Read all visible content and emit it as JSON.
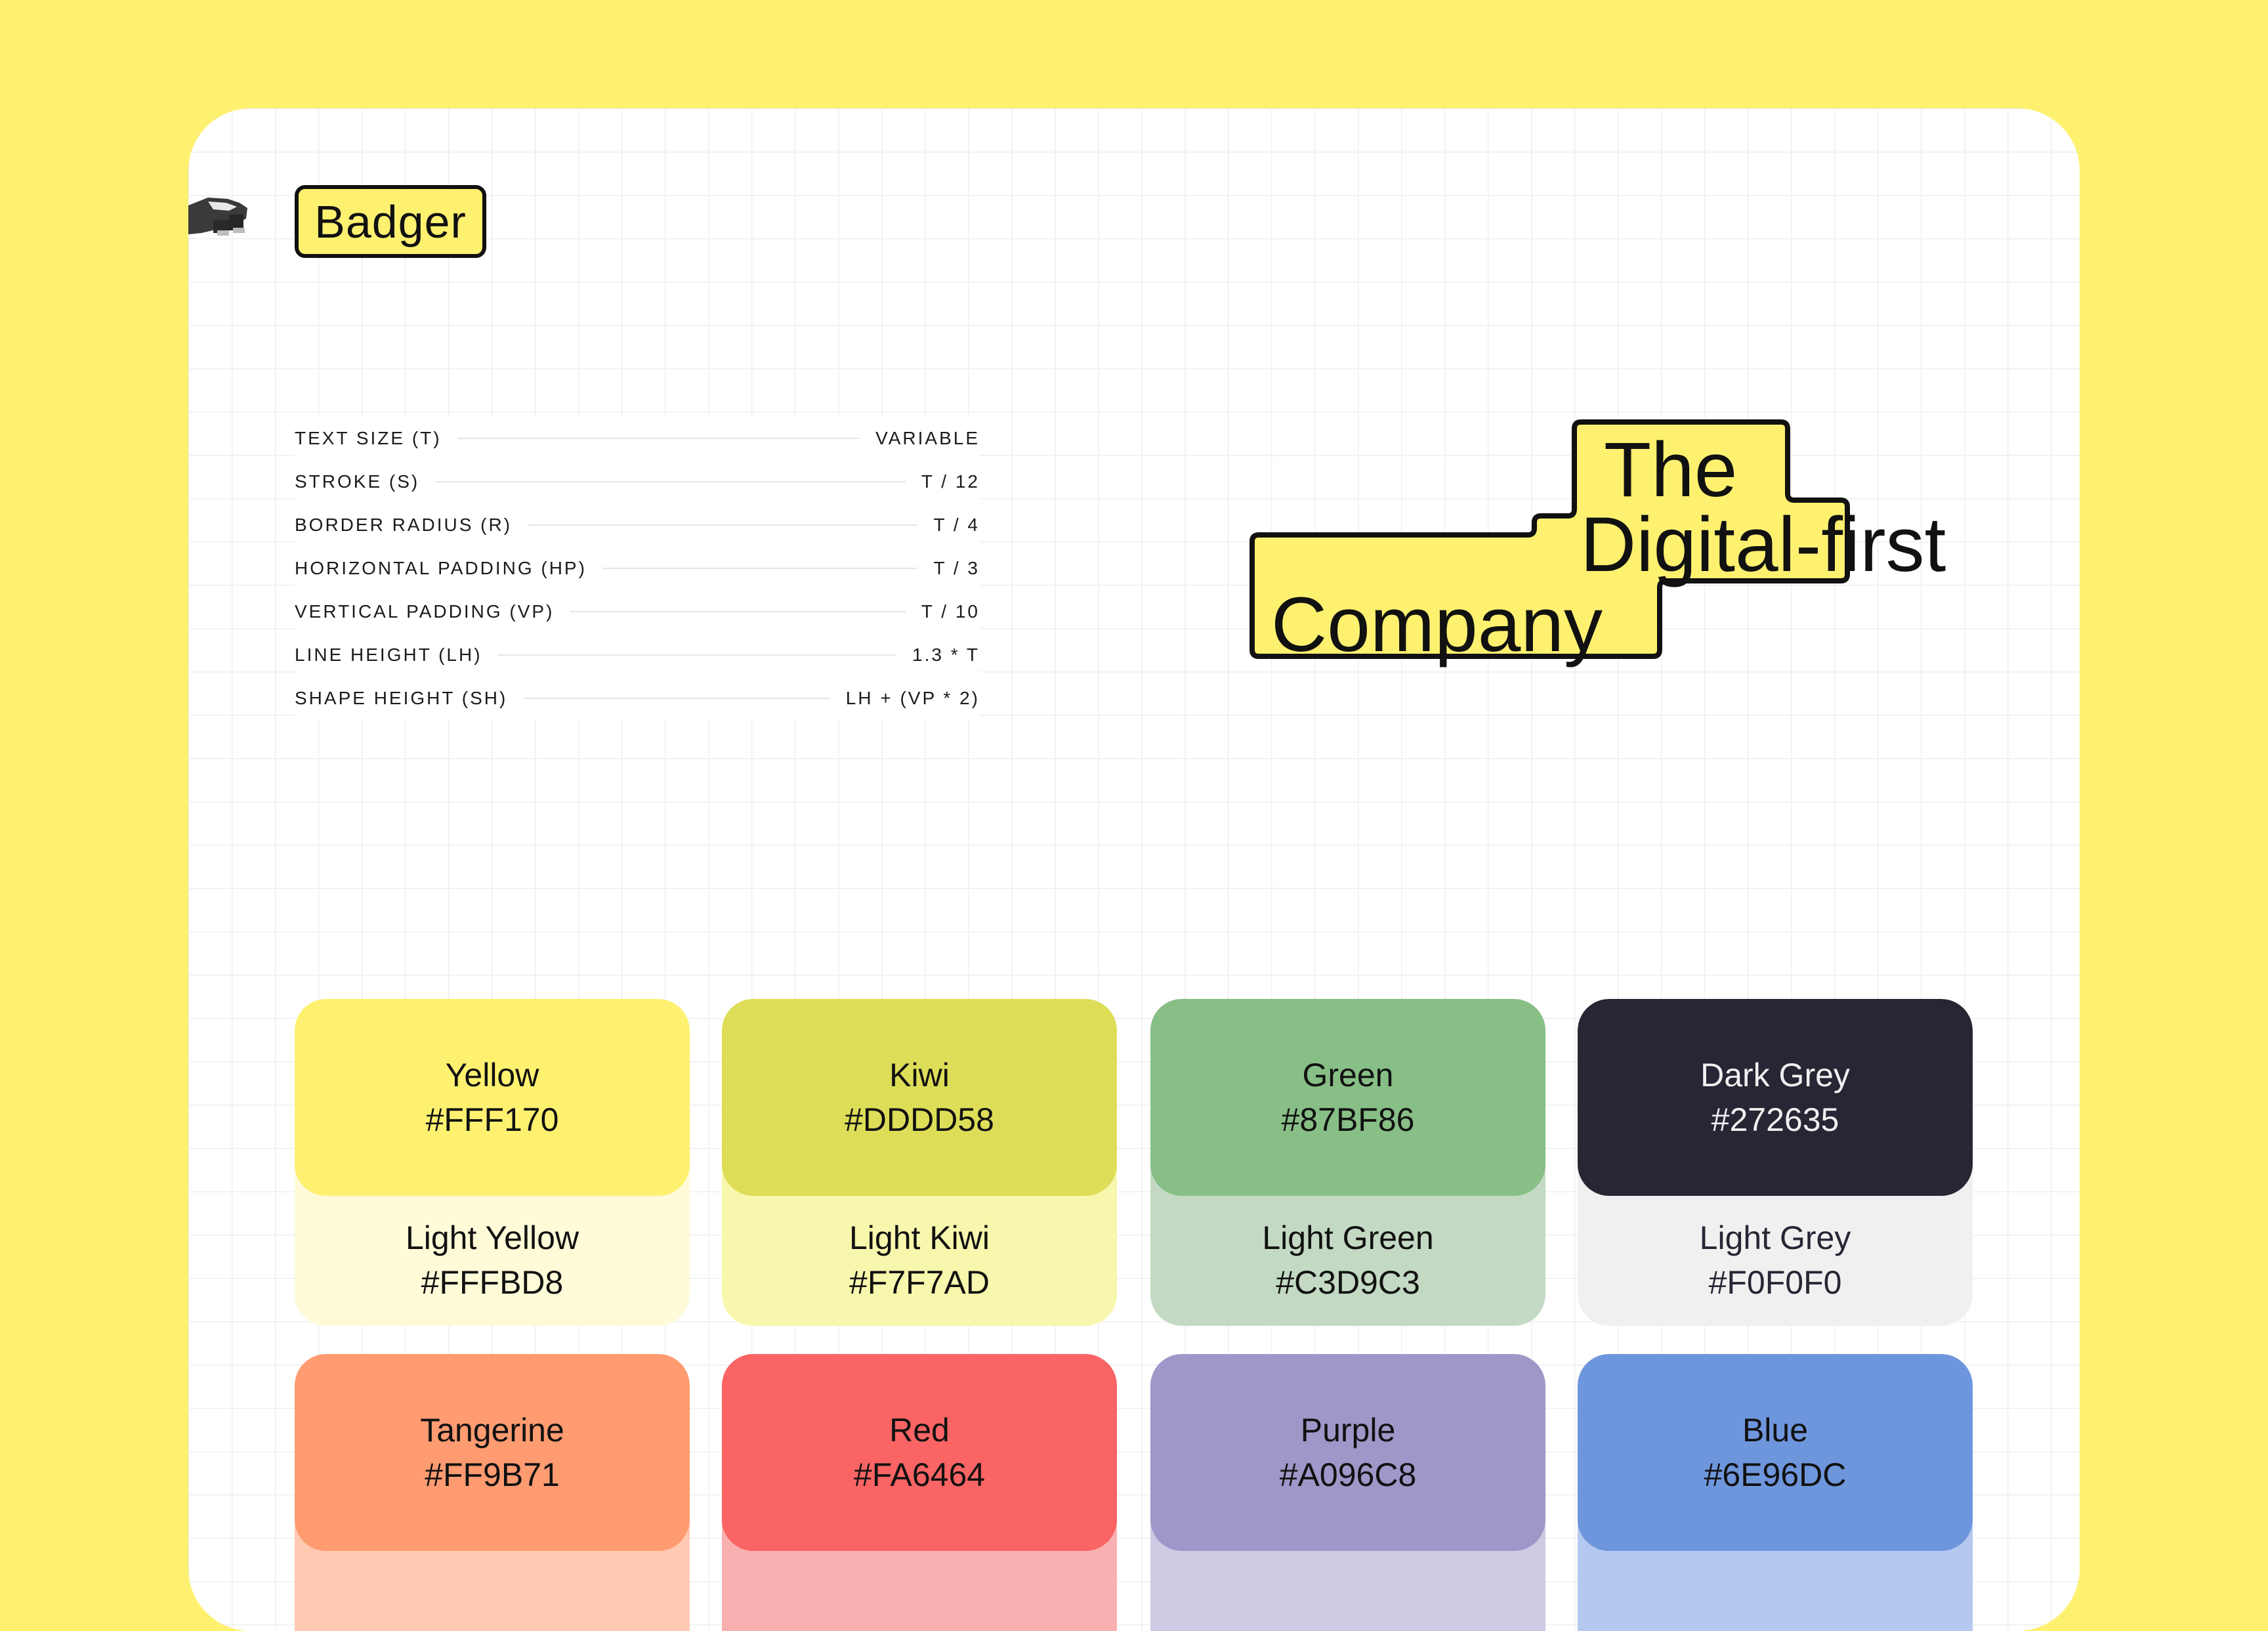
{
  "brand": {
    "name": "Badger"
  },
  "specs": [
    {
      "label": "TEXT SIZE (T)",
      "value": "VARIABLE"
    },
    {
      "label": "STROKE (S)",
      "value": "T / 12"
    },
    {
      "label": "BORDER RADIUS (R)",
      "value": "T / 4"
    },
    {
      "label": "HORIZONTAL PADDING (HP)",
      "value": "T / 3"
    },
    {
      "label": "VERTICAL PADDING (VP)",
      "value": "T / 10"
    },
    {
      "label": "LINE HEIGHT (LH)",
      "value": "1.3 * T"
    },
    {
      "label": "SHAPE HEIGHT (SH)",
      "value": "LH + (VP * 2)"
    }
  ],
  "hero": {
    "line1": "The",
    "line2": "Digital-first",
    "line3": "Company"
  },
  "palette": [
    {
      "name": "Yellow",
      "hex": "#FFF170",
      "light_name": "Light Yellow",
      "light_hex": "#FFFBD8"
    },
    {
      "name": "Kiwi",
      "hex": "#DDDD58",
      "light_name": "Light Kiwi",
      "light_hex": "#F7F7AD"
    },
    {
      "name": "Green",
      "hex": "#87BF86",
      "light_name": "Light Green",
      "light_hex": "#C3D9C3"
    },
    {
      "name": "Dark Grey",
      "hex": "#272635",
      "light_name": "Light Grey",
      "light_hex": "#F0F0F0"
    },
    {
      "name": "Tangerine",
      "hex": "#FF9B71",
      "light_name": "",
      "light_hex": ""
    },
    {
      "name": "Red",
      "hex": "#FA6464",
      "light_name": "",
      "light_hex": ""
    },
    {
      "name": "Purple",
      "hex": "#A096C8",
      "light_name": "",
      "light_hex": ""
    },
    {
      "name": "Blue",
      "hex": "#6E96DC",
      "light_name": "",
      "light_hex": ""
    }
  ],
  "colors": {
    "page_background": "#FFF170",
    "ink": "#111111",
    "tangerine_light_fill": "#FFC9B2",
    "red_light_fill": "#F9B0B0",
    "purple_light_fill": "#CFC9E3",
    "blue_light_fill": "#B4C8F0"
  },
  "icons": {
    "mascot": "badger-mascot-icon"
  }
}
